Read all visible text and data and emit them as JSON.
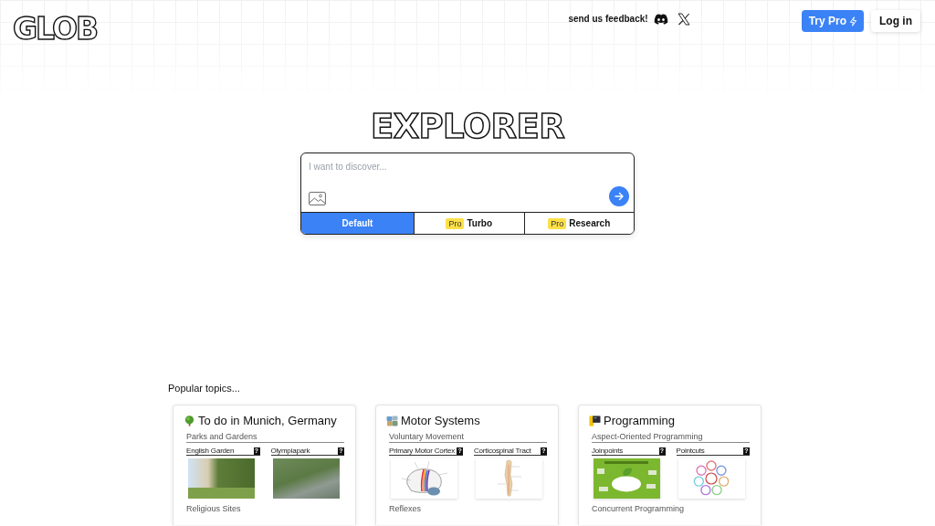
{
  "header": {
    "logo": "GLOB",
    "feedback": "send us feedback!",
    "buttons": [
      {
        "kind": "pro",
        "label": "Try Pro"
      },
      {
        "kind": "login",
        "label": "Log in"
      }
    ]
  },
  "hero": {
    "title": "EXPLORER",
    "search": {
      "placeholder": "I want to discover..."
    },
    "modes": [
      {
        "label": "Default",
        "selected": true
      },
      {
        "label": "Turbo",
        "badge": "Pro",
        "selected": false
      },
      {
        "label": "Research",
        "badge": "Pro",
        "selected": false
      }
    ]
  },
  "popular": {
    "heading": "Popular topics...",
    "topics": [
      {
        "title": "To do in Munich, Germany",
        "section": "Parks and Gardens",
        "items": [
          {
            "label": "English Garden",
            "badge": "?"
          },
          {
            "label": "Olympiapark",
            "badge": "?"
          }
        ],
        "next_section": "Religious Sites"
      },
      {
        "title": "Motor Systems",
        "section": "Voluntary Movement",
        "items": [
          {
            "label": "Primary Motor Cortex",
            "badge": "?"
          },
          {
            "label": "Corticospinal Tract",
            "badge": "?"
          }
        ],
        "next_section": "Reflexes"
      },
      {
        "title": "Programming",
        "section": "Aspect-Oriented Programming",
        "items": [
          {
            "label": "Joinpoints",
            "badge": "?"
          },
          {
            "label": "Pointcuts",
            "badge": "?"
          }
        ],
        "next_section": "Concurrent Programming"
      }
    ]
  }
}
